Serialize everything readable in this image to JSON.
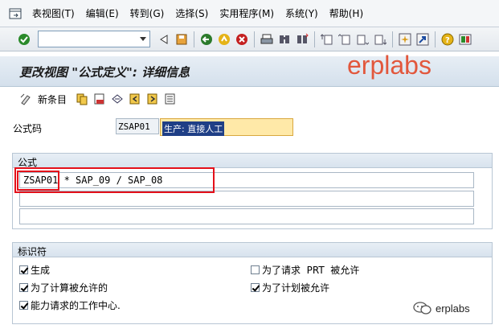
{
  "menu": [
    "表视图(T)",
    "编辑(E)",
    "转到(G)",
    "选择(S)",
    "实用程序(M)",
    "系统(Y)",
    "帮助(H)"
  ],
  "toolbar": {
    "command_value": ""
  },
  "title": "更改视图 \"公式定义\": 详细信息",
  "watermark": "erplabs",
  "app_toolbar": {
    "new_entries": "新条目"
  },
  "formula_code": {
    "label": "公式码",
    "value": "ZSAP01",
    "description": "生产: 直接人工"
  },
  "formula_group": {
    "header": "公式",
    "lines": [
      "ZSAP01 * SAP_09 / SAP_08",
      "",
      ""
    ]
  },
  "indicator_group": {
    "header": "标识符",
    "checks": [
      {
        "label": "生成",
        "checked": true
      },
      {
        "label": "为了计算被允许的",
        "checked": true
      },
      {
        "label": "能力请求的工作中心.",
        "checked": true
      },
      {
        "label": "为了请求  PRT  被允许",
        "checked": false
      },
      {
        "label": "为了计划被允许",
        "checked": true
      }
    ]
  },
  "brand": "erplabs",
  "colors": {
    "highlight": "#e4101a",
    "watermark": "#e2573c",
    "required_field": "#ffe9a8"
  }
}
